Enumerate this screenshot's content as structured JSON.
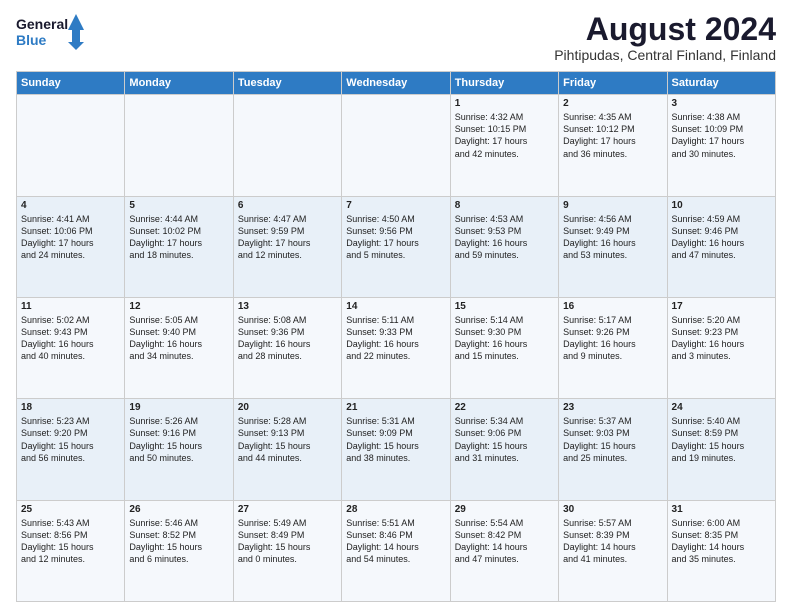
{
  "logo": {
    "line1": "General",
    "line2": "Blue"
  },
  "title": "August 2024",
  "subtitle": "Pihtipudas, Central Finland, Finland",
  "columns": [
    "Sunday",
    "Monday",
    "Tuesday",
    "Wednesday",
    "Thursday",
    "Friday",
    "Saturday"
  ],
  "weeks": [
    [
      {
        "day": "",
        "info": ""
      },
      {
        "day": "",
        "info": ""
      },
      {
        "day": "",
        "info": ""
      },
      {
        "day": "",
        "info": ""
      },
      {
        "day": "1",
        "info": "Sunrise: 4:32 AM\nSunset: 10:15 PM\nDaylight: 17 hours\nand 42 minutes."
      },
      {
        "day": "2",
        "info": "Sunrise: 4:35 AM\nSunset: 10:12 PM\nDaylight: 17 hours\nand 36 minutes."
      },
      {
        "day": "3",
        "info": "Sunrise: 4:38 AM\nSunset: 10:09 PM\nDaylight: 17 hours\nand 30 minutes."
      }
    ],
    [
      {
        "day": "4",
        "info": "Sunrise: 4:41 AM\nSunset: 10:06 PM\nDaylight: 17 hours\nand 24 minutes."
      },
      {
        "day": "5",
        "info": "Sunrise: 4:44 AM\nSunset: 10:02 PM\nDaylight: 17 hours\nand 18 minutes."
      },
      {
        "day": "6",
        "info": "Sunrise: 4:47 AM\nSunset: 9:59 PM\nDaylight: 17 hours\nand 12 minutes."
      },
      {
        "day": "7",
        "info": "Sunrise: 4:50 AM\nSunset: 9:56 PM\nDaylight: 17 hours\nand 5 minutes."
      },
      {
        "day": "8",
        "info": "Sunrise: 4:53 AM\nSunset: 9:53 PM\nDaylight: 16 hours\nand 59 minutes."
      },
      {
        "day": "9",
        "info": "Sunrise: 4:56 AM\nSunset: 9:49 PM\nDaylight: 16 hours\nand 53 minutes."
      },
      {
        "day": "10",
        "info": "Sunrise: 4:59 AM\nSunset: 9:46 PM\nDaylight: 16 hours\nand 47 minutes."
      }
    ],
    [
      {
        "day": "11",
        "info": "Sunrise: 5:02 AM\nSunset: 9:43 PM\nDaylight: 16 hours\nand 40 minutes."
      },
      {
        "day": "12",
        "info": "Sunrise: 5:05 AM\nSunset: 9:40 PM\nDaylight: 16 hours\nand 34 minutes."
      },
      {
        "day": "13",
        "info": "Sunrise: 5:08 AM\nSunset: 9:36 PM\nDaylight: 16 hours\nand 28 minutes."
      },
      {
        "day": "14",
        "info": "Sunrise: 5:11 AM\nSunset: 9:33 PM\nDaylight: 16 hours\nand 22 minutes."
      },
      {
        "day": "15",
        "info": "Sunrise: 5:14 AM\nSunset: 9:30 PM\nDaylight: 16 hours\nand 15 minutes."
      },
      {
        "day": "16",
        "info": "Sunrise: 5:17 AM\nSunset: 9:26 PM\nDaylight: 16 hours\nand 9 minutes."
      },
      {
        "day": "17",
        "info": "Sunrise: 5:20 AM\nSunset: 9:23 PM\nDaylight: 16 hours\nand 3 minutes."
      }
    ],
    [
      {
        "day": "18",
        "info": "Sunrise: 5:23 AM\nSunset: 9:20 PM\nDaylight: 15 hours\nand 56 minutes."
      },
      {
        "day": "19",
        "info": "Sunrise: 5:26 AM\nSunset: 9:16 PM\nDaylight: 15 hours\nand 50 minutes."
      },
      {
        "day": "20",
        "info": "Sunrise: 5:28 AM\nSunset: 9:13 PM\nDaylight: 15 hours\nand 44 minutes."
      },
      {
        "day": "21",
        "info": "Sunrise: 5:31 AM\nSunset: 9:09 PM\nDaylight: 15 hours\nand 38 minutes."
      },
      {
        "day": "22",
        "info": "Sunrise: 5:34 AM\nSunset: 9:06 PM\nDaylight: 15 hours\nand 31 minutes."
      },
      {
        "day": "23",
        "info": "Sunrise: 5:37 AM\nSunset: 9:03 PM\nDaylight: 15 hours\nand 25 minutes."
      },
      {
        "day": "24",
        "info": "Sunrise: 5:40 AM\nSunset: 8:59 PM\nDaylight: 15 hours\nand 19 minutes."
      }
    ],
    [
      {
        "day": "25",
        "info": "Sunrise: 5:43 AM\nSunset: 8:56 PM\nDaylight: 15 hours\nand 12 minutes."
      },
      {
        "day": "26",
        "info": "Sunrise: 5:46 AM\nSunset: 8:52 PM\nDaylight: 15 hours\nand 6 minutes."
      },
      {
        "day": "27",
        "info": "Sunrise: 5:49 AM\nSunset: 8:49 PM\nDaylight: 15 hours\nand 0 minutes."
      },
      {
        "day": "28",
        "info": "Sunrise: 5:51 AM\nSunset: 8:46 PM\nDaylight: 14 hours\nand 54 minutes."
      },
      {
        "day": "29",
        "info": "Sunrise: 5:54 AM\nSunset: 8:42 PM\nDaylight: 14 hours\nand 47 minutes."
      },
      {
        "day": "30",
        "info": "Sunrise: 5:57 AM\nSunset: 8:39 PM\nDaylight: 14 hours\nand 41 minutes."
      },
      {
        "day": "31",
        "info": "Sunrise: 6:00 AM\nSunset: 8:35 PM\nDaylight: 14 hours\nand 35 minutes."
      }
    ]
  ]
}
